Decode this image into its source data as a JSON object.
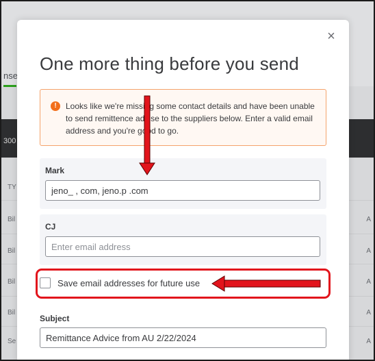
{
  "background": {
    "tab_fragment": "nse",
    "band_fragment": "300",
    "column_fragment": "TY",
    "row_fragments": [
      "Bil",
      "Bil",
      "Bil",
      "Bil",
      "Se"
    ],
    "right_marks": [
      "A",
      "A",
      "A",
      "A",
      "A"
    ]
  },
  "modal": {
    "title": "One more thing before you send",
    "alert": {
      "icon": "!",
      "message": "Looks like we're missing some contact details and have been unable to send remittence advise to the suppliers below. Enter a valid email address and you're good to go."
    },
    "contacts": [
      {
        "name": "Mark",
        "email_value": "jeno_ , com, jeno.p .com",
        "email_placeholder": "Enter email address"
      },
      {
        "name": "CJ",
        "email_value": "",
        "email_placeholder": "Enter email address"
      }
    ],
    "save_checkbox": {
      "label": "Save email addresses for future use",
      "checked": false
    },
    "subject": {
      "label": "Subject",
      "value": "Remittance Advice from AU 2/22/2024"
    }
  },
  "colors": {
    "annotation_red": "#e2141c",
    "alert_orange": "#f26f1c",
    "accent_green": "#2ca01c"
  }
}
